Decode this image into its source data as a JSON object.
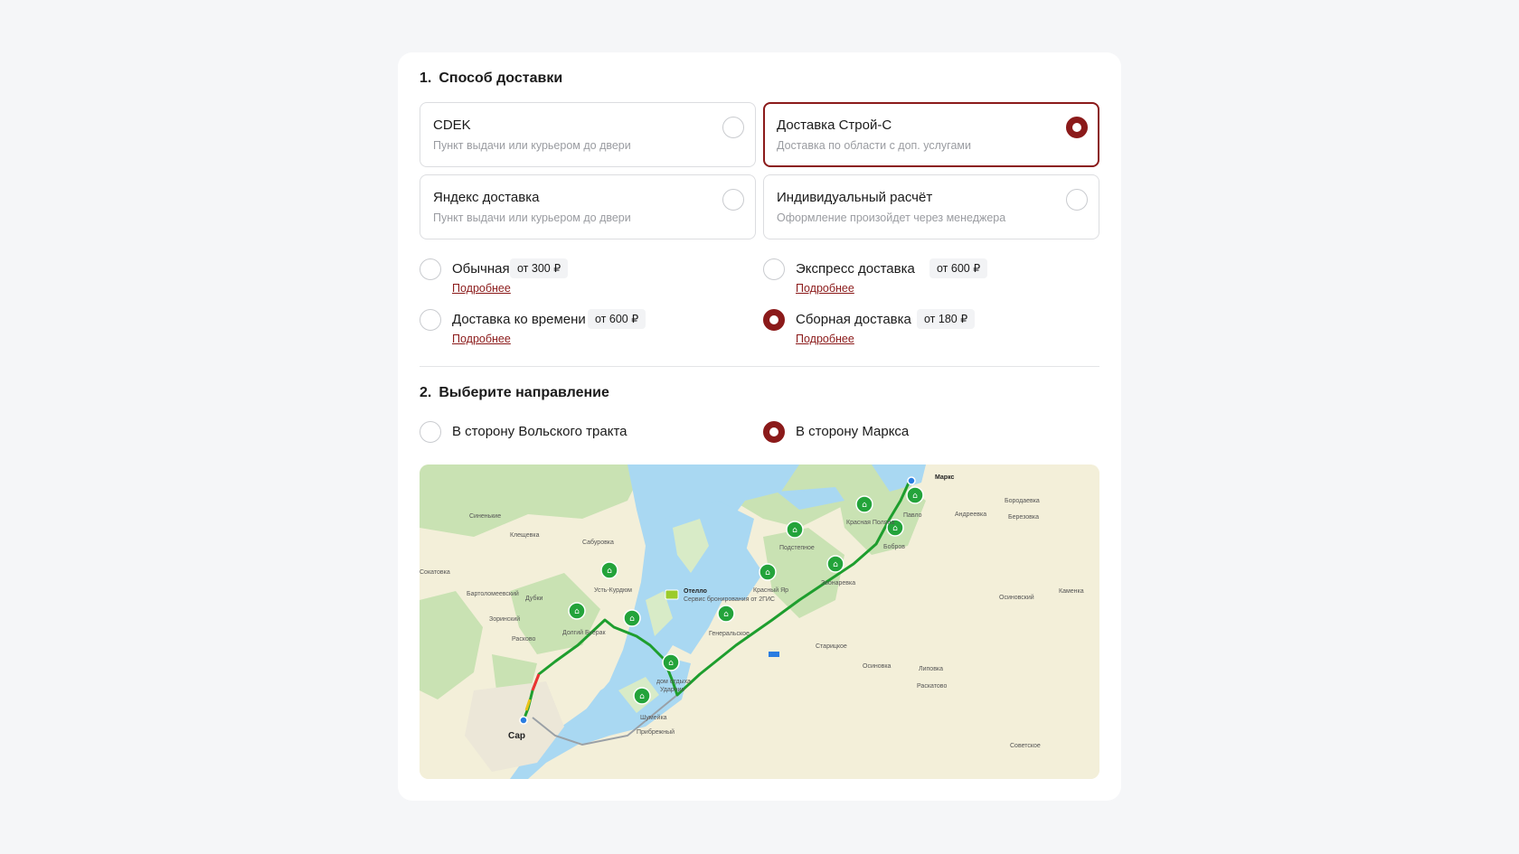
{
  "section1": {
    "number": "1.",
    "title": "Способ доставки"
  },
  "providers": [
    {
      "title": "CDEK",
      "subtitle": "Пункт выдачи или курьером до двери",
      "selected": false
    },
    {
      "title": "Доставка Строй-С",
      "subtitle": "Доставка по области с доп. услугами",
      "selected": true
    },
    {
      "title": "Яндекс доставка",
      "subtitle": "Пункт выдачи или курьером до двери",
      "selected": false
    },
    {
      "title": "Индивидуальный расчёт",
      "subtitle": "Оформление произойдет через менеджера",
      "selected": false
    }
  ],
  "delivery_types": [
    {
      "name": "Обычная",
      "price": "от 300 ₽",
      "more": "Подробнее",
      "selected": false
    },
    {
      "name": "Экспресс доставка",
      "price": "от 600 ₽",
      "more": "Подробнее",
      "selected": false
    },
    {
      "name": "Доставка ко времени",
      "price": "от 600 ₽",
      "more": "Подробнее",
      "selected": false
    },
    {
      "name": "Сборная доставка",
      "price": "от 180 ₽",
      "more": "Подробнее",
      "selected": true
    }
  ],
  "section2": {
    "number": "2.",
    "title": "Выберите направление"
  },
  "directions": [
    {
      "name": "В сторону Вольского тракта",
      "selected": false
    },
    {
      "name": "В сторону Маркса",
      "selected": true
    }
  ],
  "map": {
    "places": {
      "marks": "Маркс",
      "borodaevka": "Бородаевка",
      "andreevka": "Андреевка",
      "berezovka": "Березовка",
      "pavlovka": "Павло",
      "krasnaya_polyana": "Красная Поляна",
      "bobrovka": "Бобров",
      "podstepnoe": "Подстепное",
      "zvonarevka": "Звонаревка",
      "krasny_yar": "Красный Яр",
      "generalskoe": "Генеральское",
      "otello": "Отелло",
      "otello_sub": "Сервис бронирования от 2ГИС",
      "sinenkie": "Синенькие",
      "klyuchevka": "Клещевка",
      "saburovka": "Сабуровка",
      "ust_kurdyum": "Усть-Курдюм",
      "sokolovka": "Сокатовка",
      "bartolomeevsky": "Бартоломеевский",
      "dubki": "Дубки",
      "zorinsky": "Зоринский",
      "rasskazovo": "Расково",
      "dolgy_buerak": "Долгий Буерак",
      "dom_otdykha": "дом отдыха",
      "udarnik": "Ударник",
      "shumeyka": "Шумейка",
      "pribrezhny": "Прибрежный",
      "staritskoe": "Старицкое",
      "osinovka": "Осиновка",
      "lipovka": "Липовка",
      "raskatovo": "Раскатово",
      "osinovsky": "Осиновский",
      "kamenka": "Каменка",
      "sovetskoe": "Советское",
      "saratov": "Сар"
    },
    "colors": {
      "route": "#1e9e2e",
      "water": "#a9d8f2",
      "land": "#f3efd9",
      "forest": "#c9e2b3",
      "marker": "#23a33a"
    }
  }
}
